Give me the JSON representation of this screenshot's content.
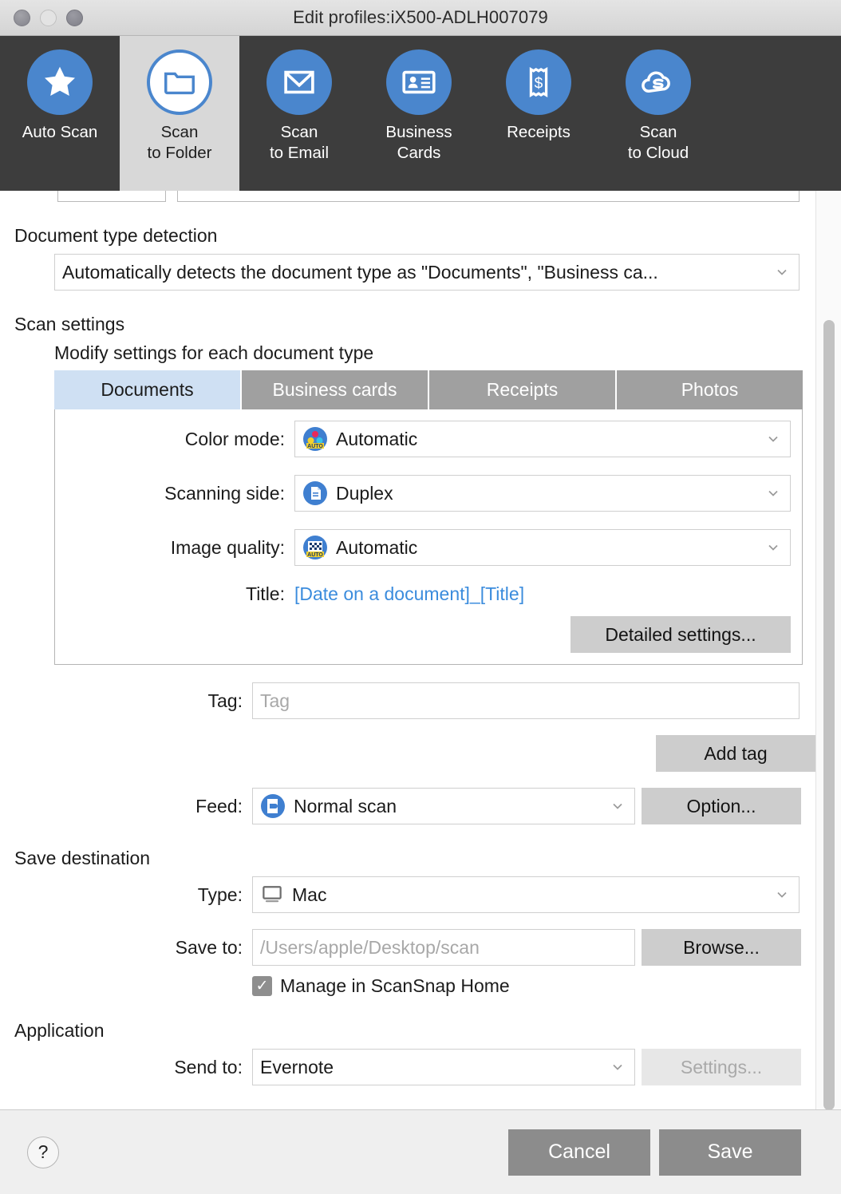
{
  "window": {
    "title": "Edit profiles:iX500-ADLH007079",
    "traffic_lights": [
      "close",
      "minimize",
      "zoom"
    ]
  },
  "toolbar": {
    "profiles": [
      {
        "label": "Auto Scan",
        "icon": "star-icon",
        "selected": false
      },
      {
        "label": "Scan\nto Folder",
        "icon": "folder-icon",
        "selected": true
      },
      {
        "label": "Scan\nto Email",
        "icon": "envelope-icon",
        "selected": false
      },
      {
        "label": "Business\nCards",
        "icon": "business-card-icon",
        "selected": false
      },
      {
        "label": "Receipts",
        "icon": "receipt-icon",
        "selected": false
      },
      {
        "label": "Scan\nto Cloud",
        "icon": "cloud-icon",
        "selected": false
      }
    ]
  },
  "document_type_detection": {
    "section_label": "Document type detection",
    "value": "Automatically detects the document type as \"Documents\", \"Business ca...",
    "chevron": "chevron-down-icon"
  },
  "scan_settings": {
    "section_label": "Scan settings",
    "sub_label": "Modify settings for each document type",
    "tabs": [
      {
        "label": "Documents",
        "active": true
      },
      {
        "label": "Business cards",
        "active": false
      },
      {
        "label": "Receipts",
        "active": false
      },
      {
        "label": "Photos",
        "active": false
      }
    ],
    "fields": {
      "color_mode": {
        "label": "Color mode:",
        "value": "Automatic",
        "icon": "color-auto-icon"
      },
      "scanning_side": {
        "label": "Scanning side:",
        "value": "Duplex",
        "icon": "duplex-page-icon"
      },
      "image_quality": {
        "label": "Image quality:",
        "value": "Automatic",
        "icon": "quality-auto-icon"
      },
      "title": {
        "label": "Title:",
        "value": "[Date on a document]_[Title]"
      }
    },
    "detailed_settings_label": "Detailed settings...",
    "tag": {
      "label": "Tag:",
      "value": "",
      "placeholder": "Tag"
    },
    "add_tag_label": "Add tag",
    "feed": {
      "label": "Feed:",
      "value": "Normal scan",
      "icon": "feed-scan-icon"
    },
    "option_label": "Option..."
  },
  "save_destination": {
    "section_label": "Save destination",
    "type": {
      "label": "Type:",
      "value": "Mac",
      "icon": "monitor-icon"
    },
    "save_to": {
      "label": "Save to:",
      "value": "",
      "placeholder": "/Users/apple/Desktop/scan"
    },
    "browse_label": "Browse...",
    "manage_checkbox": {
      "label": "Manage in ScanSnap Home",
      "checked": true,
      "mark": "✓"
    }
  },
  "application": {
    "section_label": "Application",
    "send_to": {
      "label": "Send to:",
      "value": "Evernote"
    },
    "settings_label": "Settings...",
    "settings_disabled": true
  },
  "footer": {
    "help_label": "?",
    "cancel_label": "Cancel",
    "save_label": "Save"
  },
  "colors": {
    "accent_blue": "#4a86cd",
    "link_blue": "#3b8cdd",
    "toolbar_dark": "#3d3d3d",
    "tab_active": "#cfe0f3",
    "tab_inactive": "#a0a0a0",
    "button_gray": "#8c8c8c"
  }
}
